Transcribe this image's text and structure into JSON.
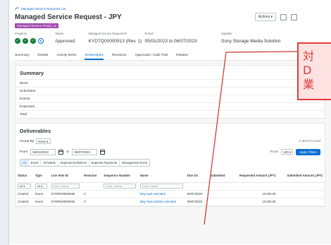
{
  "breadcrumb": "Managed Service Requests List",
  "page_title": "Managed Service Request - JPY",
  "status_badge": "Managed Service (Final)_v2",
  "toolbar": {
    "actions_label": "Actions"
  },
  "attributes": {
    "labels": {
      "progress": "Progress",
      "status": "Status",
      "request_id": "Managed Service Request ID",
      "period": "Period",
      "supplier": "Supplier"
    },
    "values": {
      "status": "Approved",
      "request_id": "KYDTQ00000913 (Rev. 1)",
      "period": "05/01/2023 to 06/07/2023",
      "supplier": "Sony Storage Media Solution"
    }
  },
  "tabs": [
    "Summary",
    "Details",
    "Activity Items",
    "Deliverables",
    "Revisions",
    "Approvals / Audit Trail",
    "Related"
  ],
  "active_tab": "Deliverables",
  "summary": {
    "title": "Summary",
    "rows": [
      "Items",
      "Schedules",
      "Events",
      "Expenses",
      "Total"
    ],
    "right_header": "G"
  },
  "deliverables": {
    "title": "Deliverables",
    "group_by_label": "Group By",
    "group_by_value": "None",
    "items_found": "2 Items Found",
    "from_label": "From",
    "from_date": "05/01/2023",
    "to_label": "to",
    "to_date": "06/07/2023",
    "rows_label": "Rows",
    "rows_value": "100",
    "apply_label": "Apply Filters",
    "segments": [
      "All",
      "Event",
      "Schedule",
      "Expense Definitions",
      "Expense Payments",
      "Management Event"
    ],
    "columns": [
      "Status",
      "Type",
      "Line Item ID",
      "Revision",
      "Sequence Number",
      "Name",
      "Due On",
      "Submitted",
      "Requested Amount (JPY)",
      "Submitted Amount (JPY)"
    ],
    "filters": {
      "status": "All",
      "type": "All",
      "line_item": "Enter Criteria",
      "sequence": "Enter Criteria",
      "name": "Enter Criteria"
    },
    "rows": [
      {
        "status": "Created",
        "type": "Event",
        "line_item": "KYDPE00000495",
        "revision": "0",
        "sequence": "",
        "name": "May task extended",
        "due_on": "06/07/2023",
        "submitted": "",
        "requested": "10,000.00",
        "submitted_amt": ""
      },
      {
        "status": "Created",
        "type": "Event",
        "line_item": "KYDPE00000496",
        "revision": "0",
        "sequence": "",
        "name": "May Task double extended",
        "due_on": "06/07/2023",
        "submitted": "",
        "requested": "10,000.00",
        "submitted_amt": ""
      }
    ]
  },
  "callout": {
    "line1": "対",
    "line2": "D",
    "line3": "業"
  },
  "colors": {
    "accent": "#0a6ed1",
    "success": "#107e3e",
    "badge": "#a046b0",
    "callout_border": "#e23b3b",
    "callout_fill": "#fde2e2"
  }
}
